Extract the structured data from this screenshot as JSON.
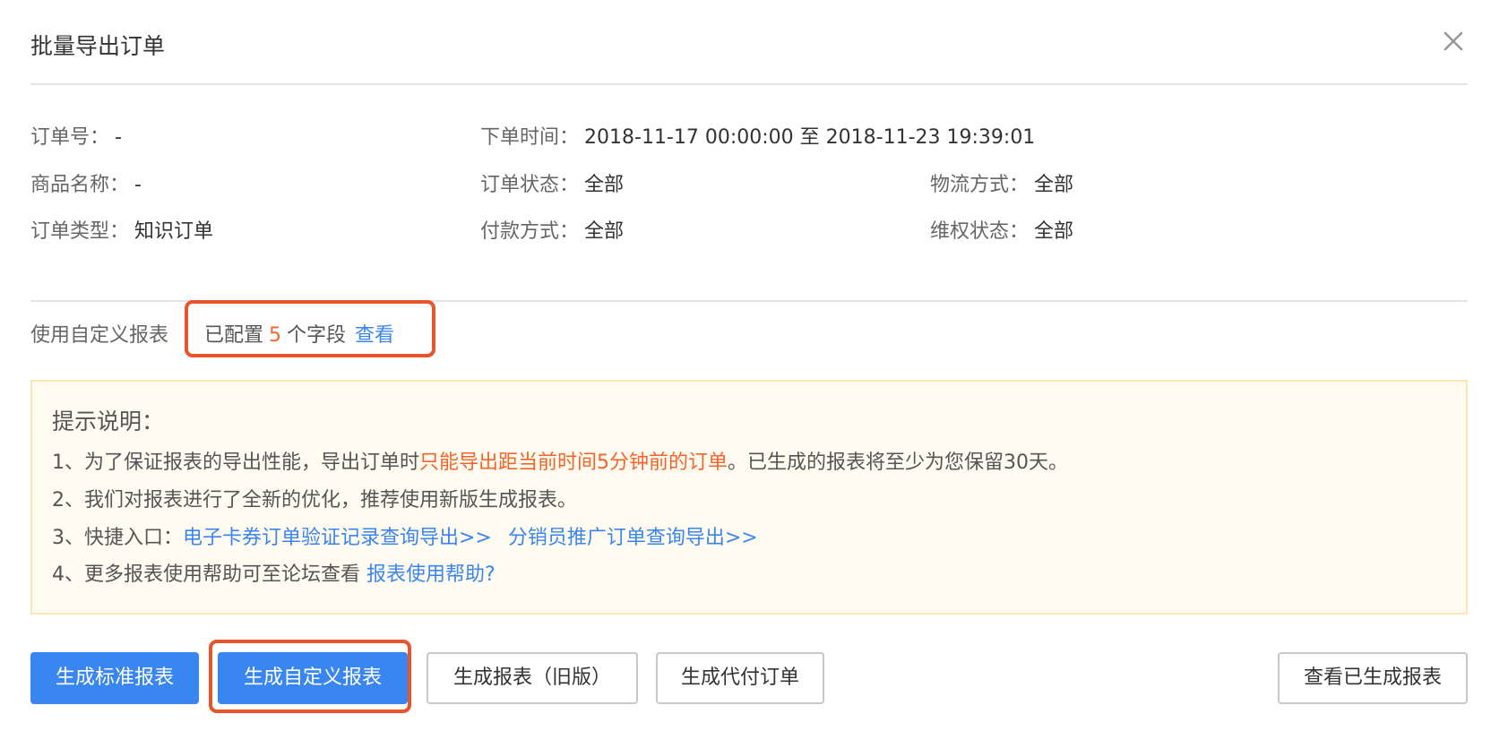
{
  "dialog": {
    "title": "批量导出订单",
    "close_icon": "close-icon"
  },
  "filters": {
    "order_no": {
      "label": "订单号：",
      "value": "-"
    },
    "order_time": {
      "label": "下单时间：",
      "value": "2018-11-17 00:00:00 至 2018-11-23 19:39:01"
    },
    "product_name": {
      "label": "商品名称：",
      "value": "-"
    },
    "order_status": {
      "label": "订单状态：",
      "value": "全部"
    },
    "logistics": {
      "label": "物流方式：",
      "value": "全部"
    },
    "order_type": {
      "label": "订单类型：",
      "value": "知识订单"
    },
    "payment": {
      "label": "付款方式：",
      "value": "全部"
    },
    "rights_status": {
      "label": "维权状态：",
      "value": "全部"
    }
  },
  "custom_report": {
    "label": "使用自定义报表",
    "configured_prefix": "已配置",
    "configured_count": "5",
    "configured_suffix": "个字段",
    "view_link": "查看"
  },
  "notice": {
    "title": "提示说明：",
    "line1_a": "1、为了保证报表的导出性能，导出订单时",
    "line1_warn": "只能导出距当前时间5分钟前的订单",
    "line1_b": "。已生成的报表将至少为您保留30天。",
    "line2": "2、我们对报表进行了全新的优化，推荐使用新版生成报表。",
    "line3_prefix": "3、快捷入口：",
    "line3_link1": "电子卡券订单验证记录查询导出>>",
    "line3_link2": "分销员推广订单查询导出>>",
    "line4_prefix": "4、更多报表使用帮助可至论坛查看",
    "line4_link": "报表使用帮助?"
  },
  "buttons": {
    "standard": "生成标准报表",
    "custom": "生成自定义报表",
    "legacy": "生成报表（旧版）",
    "proxy_pay": "生成代付订单",
    "view_generated": "查看已生成报表"
  },
  "colors": {
    "primary": "#3a86f0",
    "warning": "#f5652a",
    "highlight_box": "#e8542b",
    "notice_bg": "#fffbf0"
  }
}
